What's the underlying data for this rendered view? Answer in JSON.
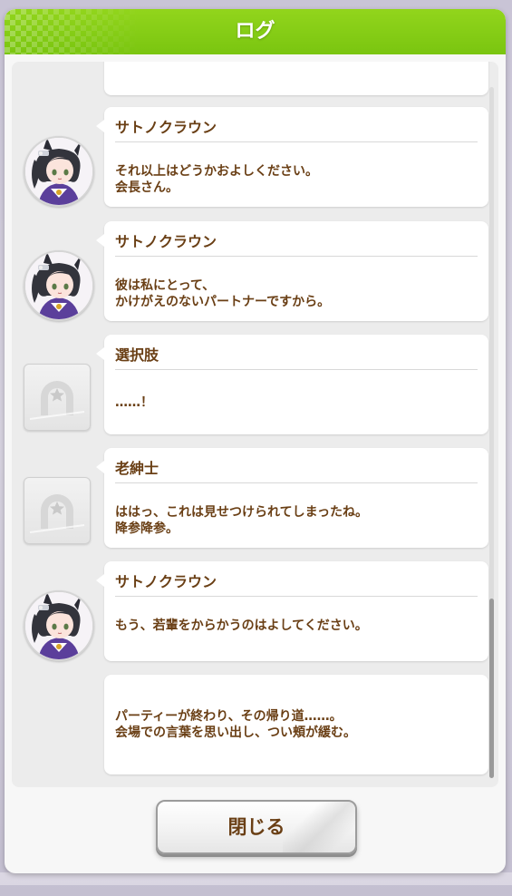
{
  "window": {
    "title": "ログ"
  },
  "log": {
    "entries": [
      {
        "type": "partial",
        "speaker": "",
        "text": ""
      },
      {
        "type": "character",
        "avatar": "satono-crown-avatar",
        "speaker": "サトノクラウン",
        "text": "それ以上はどうかおよしください。\n会長さん。"
      },
      {
        "type": "character",
        "avatar": "satono-crown-avatar",
        "speaker": "サトノクラウン",
        "text": "彼は私にとって、\nかけがえのないパートナーですから。"
      },
      {
        "type": "placeholder",
        "avatar": "horseshoe-placeholder-icon",
        "speaker": "選択肢",
        "text": "……！"
      },
      {
        "type": "placeholder",
        "avatar": "horseshoe-placeholder-icon",
        "speaker": "老紳士",
        "text": "ははっ、これは見せつけられてしまったね。\n降参降参。"
      },
      {
        "type": "character",
        "avatar": "satono-crown-avatar",
        "speaker": "サトノクラウン",
        "text": "もう、若輩をからかうのはよしてください。"
      },
      {
        "type": "narration",
        "speaker": "",
        "text": "パーティーが終わり、その帰り道……。\n会場での言葉を思い出し、つい頬が緩む。"
      }
    ]
  },
  "close_button": {
    "label": "閉じる"
  },
  "colors": {
    "header": "#8ccf18",
    "text_brown": "#6a3f15",
    "panel": "#f7f7f7"
  }
}
